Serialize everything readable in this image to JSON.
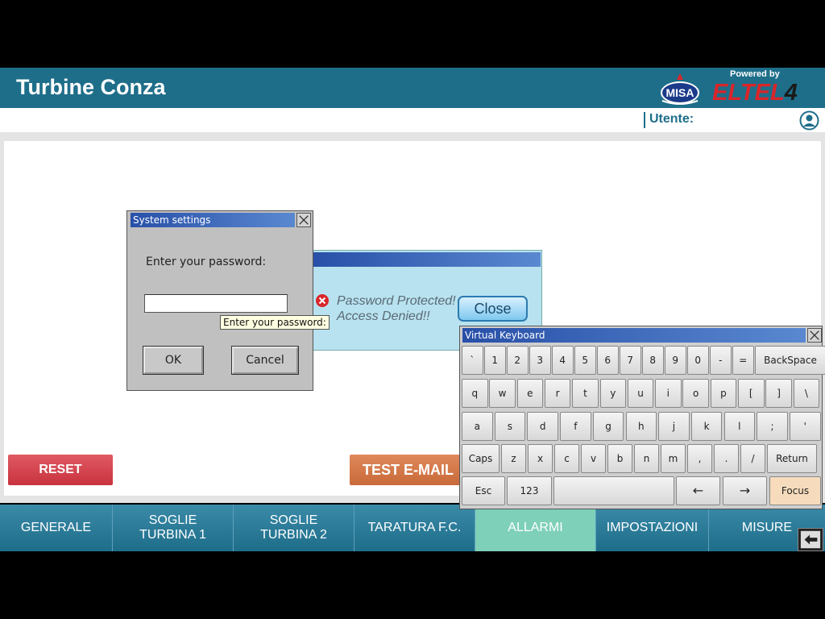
{
  "header": {
    "title": "Turbine Conza",
    "misa_logo_text": "MISA",
    "powered_by": "Powered by",
    "eltel_logo_text": "ELTEL",
    "eltel_logo_number": "4"
  },
  "userbar": {
    "user_label": "Utente:",
    "user_value": ""
  },
  "main": {
    "reset_label": "RESET",
    "test_email_label": "TEST E-MAIL"
  },
  "nav": {
    "items": [
      {
        "line1": "GENERALE",
        "line2": ""
      },
      {
        "line1": "SOGLIE",
        "line2": "TURBINA 1"
      },
      {
        "line1": "SOGLIE",
        "line2": "TURBINA 2"
      },
      {
        "line1": "TARATURA F.C.",
        "line2": ""
      },
      {
        "line1": "ALLARMI",
        "line2": ""
      },
      {
        "line1": "IMPOSTAZIONI",
        "line2": ""
      },
      {
        "line1": "MISURE",
        "line2": ""
      }
    ],
    "active_index": 4
  },
  "system_dialog": {
    "title": "System settings",
    "prompt": "Enter your password:",
    "password_value": "",
    "tooltip": "Enter your password:",
    "ok_label": "OK",
    "cancel_label": "Cancel"
  },
  "denied_dialog": {
    "line1": "Password Protected!",
    "line2": "Access Denied!!",
    "close_label": "Close"
  },
  "keyboard": {
    "title": "Virtual Keyboard",
    "rows": [
      [
        "`",
        "1",
        "2",
        "3",
        "4",
        "5",
        "6",
        "7",
        "8",
        "9",
        "0",
        "-",
        "=",
        "BackSpace"
      ],
      [
        "q",
        "w",
        "e",
        "r",
        "t",
        "y",
        "u",
        "i",
        "o",
        "p",
        "[",
        "]",
        "\\"
      ],
      [
        "a",
        "s",
        "d",
        "f",
        "g",
        "h",
        "j",
        "k",
        "l",
        ";",
        "'"
      ],
      [
        "Caps",
        "z",
        "x",
        "c",
        "v",
        "b",
        "n",
        "m",
        ",",
        ".",
        "/",
        "Return"
      ],
      [
        "Esc",
        "123",
        "",
        "←",
        "→",
        "Focus"
      ]
    ]
  },
  "colors": {
    "header_bg": "#1e6e8a",
    "nav_active": "#7ed0b8",
    "reset_red": "#c8323e",
    "test_email_orange": "#c86a3a",
    "brand_red": "#d9262a"
  }
}
